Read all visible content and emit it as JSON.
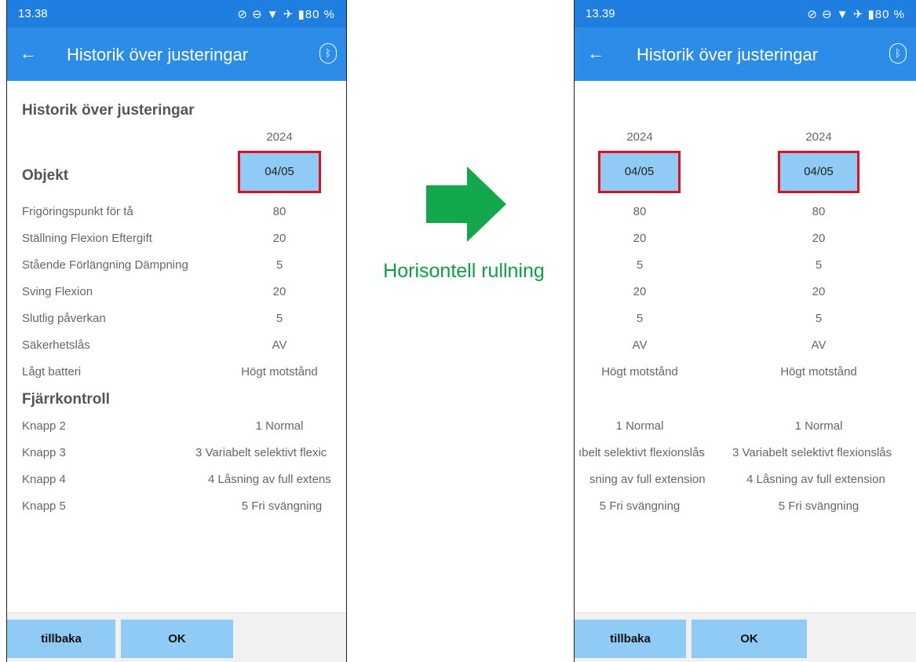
{
  "status_left": {
    "time": "13.38",
    "icons": "🗋 ⓘ"
  },
  "status_right": {
    "time": "13.39",
    "icons": "🗋 ⓘ"
  },
  "status_icons_right": "⊘ ⊖ ▼ ✈ ▮80 %",
  "appbar": {
    "back": "←",
    "title": "Historik över justeringar",
    "bluetooth": "ᛒ"
  },
  "left_screen": {
    "heading": "Historik över justeringar",
    "year": "2024",
    "date": "04/05",
    "section_objekt": "Objekt",
    "rows": [
      {
        "label": "Frigöringspunkt för tå",
        "value": "80"
      },
      {
        "label": "Ställning Flexion Eftergift",
        "value": "20"
      },
      {
        "label": "Stående Förlängning Dämpning",
        "value": "5"
      },
      {
        "label": "Sving Flexion",
        "value": "20"
      },
      {
        "label": "Slutlig påverkan",
        "value": "5"
      },
      {
        "label": "Säkerhetslås",
        "value": "AV"
      },
      {
        "label": "Lågt batteri",
        "value": "Högt motstånd"
      }
    ],
    "section_remote": "Fjärrkontroll",
    "remote_rows": [
      {
        "label": "Knapp 2",
        "value": "1 Normal"
      },
      {
        "label": "Knapp 3",
        "value": "3 Variabelt selektivt flexic"
      },
      {
        "label": "Knapp 4",
        "value": "4 Låsning av full extens"
      },
      {
        "label": "Knapp 5",
        "value": "5 Fri svängning"
      }
    ]
  },
  "right_screen": {
    "col1": {
      "year": "2024",
      "date": "04/05",
      "values": [
        "80",
        "20",
        "5",
        "20",
        "5",
        "AV",
        "Högt motstånd"
      ],
      "remote": [
        "1 Normal",
        "ıbelt selektivt flexionslås",
        "sning av full extension",
        "5 Fri svängning"
      ]
    },
    "col2": {
      "year": "2024",
      "date": "04/05",
      "values": [
        "80",
        "20",
        "5",
        "20",
        "5",
        "AV",
        "Högt motstånd"
      ],
      "remote": [
        "1 Normal",
        "3 Variabelt selektivt flexionslås",
        "4 Låsning av full extension",
        "5 Fri svängning"
      ]
    }
  },
  "buttons": {
    "back": "tillbaka",
    "ok": "OK"
  },
  "arrow_label": "Horisontell rullning",
  "colors": {
    "appbar": "#2b8de8",
    "highlight": "#e0101c",
    "date_bg": "#8fcbf4",
    "arrow": "#14a84d"
  }
}
